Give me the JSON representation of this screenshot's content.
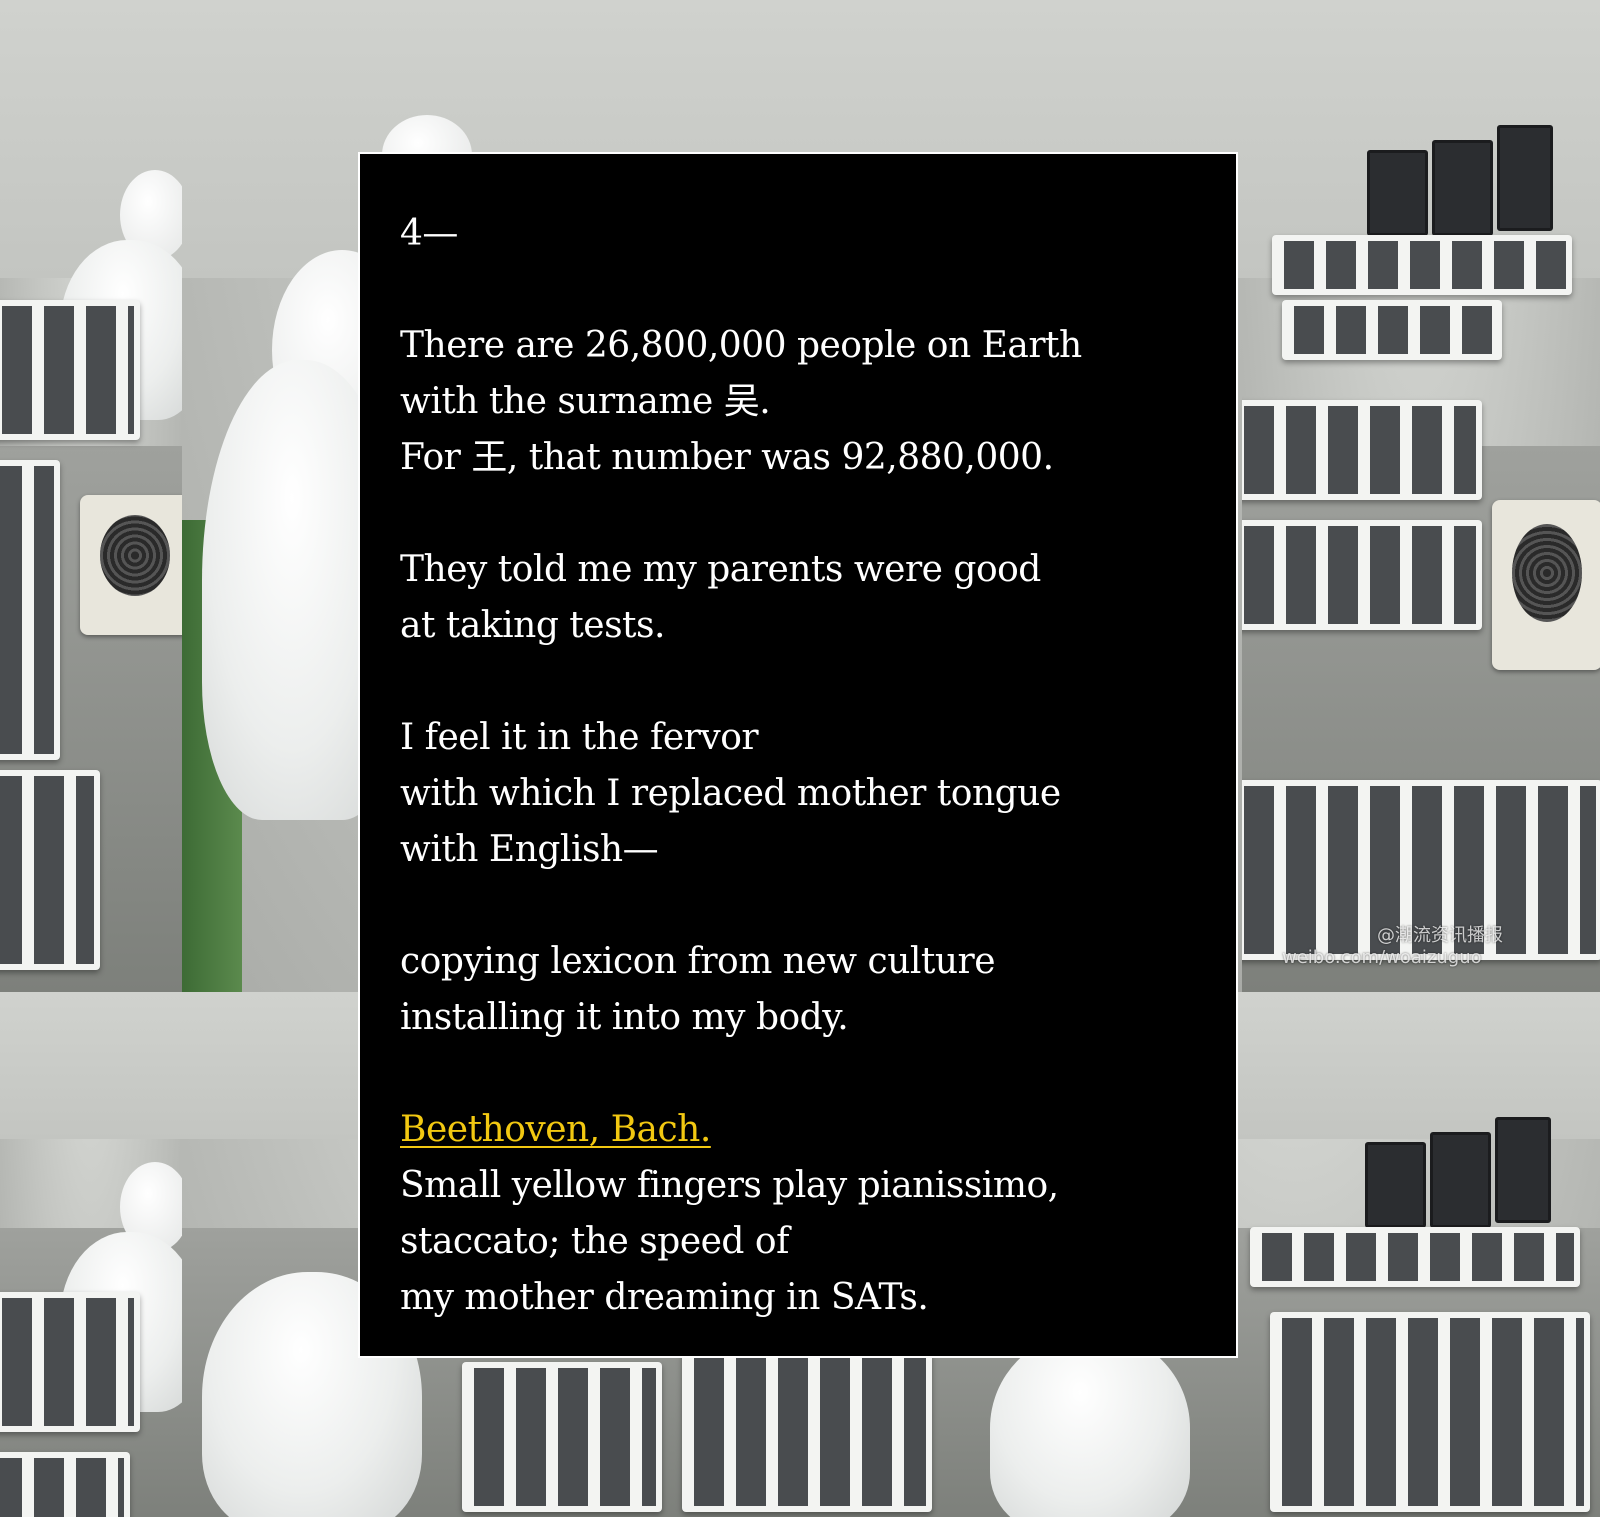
{
  "section_number": "4—",
  "stanzas": {
    "s1": {
      "l1": "There are 26,800,000 people on Earth",
      "l2": "with the surname 吴.",
      "l3": "For 王, that number was 92,880,000."
    },
    "s2": {
      "l1": "They told me my parents were good",
      "l2": "at taking tests."
    },
    "s3": {
      "l1": "I feel it in the fervor",
      "l2": "with which I replaced mother tongue",
      "l3": "with English—"
    },
    "s4": {
      "l1": "copying lexicon from new culture",
      "l2": "installing it into my body."
    },
    "s5": {
      "link": "Beethoven, Bach.",
      "l1": "Small yellow fingers play pianissimo,",
      "l2": "staccato; the speed of",
      "l3": "my mother dreaming in SATs."
    }
  },
  "background": {
    "watermark_handle": "@潮流资讯播报",
    "watermark_url": "weibo.com/woaizuguo"
  },
  "colors": {
    "panel": "#000000",
    "text": "#ffffff",
    "link": "#f2c811"
  }
}
